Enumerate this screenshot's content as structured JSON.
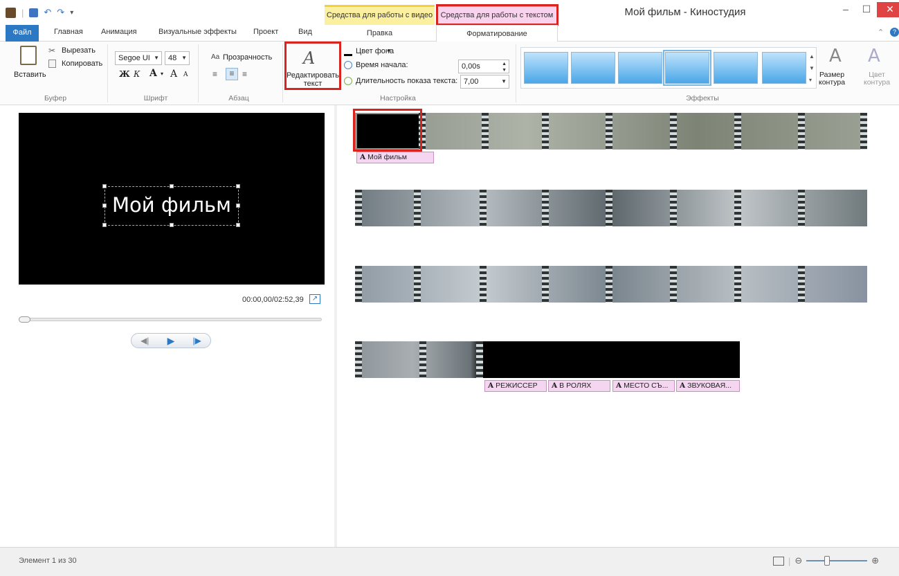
{
  "window": {
    "title": "Мой фильм - Киностудия",
    "minimize": "–",
    "maximize": "☐",
    "close": "✕"
  },
  "context_tabs": {
    "video_tools": "Средства для работы с видео",
    "text_tools": "Средства для работы с текстом"
  },
  "tabs": {
    "file": "Файл",
    "home": "Главная",
    "animation": "Анимация",
    "visual_effects": "Визуальные эффекты",
    "project": "Проект",
    "view": "Вид",
    "edit": "Правка",
    "format": "Форматирование"
  },
  "ribbon": {
    "clipboard": {
      "paste": "Вставить",
      "cut": "Вырезать",
      "copy": "Копировать",
      "group": "Буфер"
    },
    "font": {
      "family": "Segoe UI",
      "size": "48",
      "bold": "Ж",
      "italic": "К",
      "color": "A",
      "grow": "A",
      "shrink": "A",
      "group": "Шрифт"
    },
    "paragraph": {
      "transparency": "Прозрачность",
      "group": "Абзац"
    },
    "edit_text": {
      "line1": "Редактировать",
      "line2": "текст"
    },
    "settings": {
      "bg_color": "Цвет фона",
      "start_time_label": "Время начала:",
      "start_time": "0,00s",
      "duration_label": "Длительность показа текста:",
      "duration": "7,00",
      "group": "Настройка"
    },
    "effects": {
      "group": "Эффекты",
      "outline_size_1": "Размер",
      "outline_size_2": "контура",
      "outline_color_1": "Цвет",
      "outline_color_2": "контура"
    }
  },
  "preview": {
    "text": "Мой фильм",
    "timecode": "00:00,00/02:52,39"
  },
  "storyboard": {
    "caption_first": "Мой фильм",
    "captions_end": [
      "РЕЖИССЕР",
      "В РОЛЯХ",
      "МЕСТО СЪ...",
      "ЗВУКОВАЯ..."
    ]
  },
  "status": {
    "text": "Элемент 1 из 30"
  },
  "icons": [
    "film-icon",
    "save-icon",
    "undo-icon",
    "redo-icon",
    "paste-icon",
    "cut-icon",
    "copy-icon",
    "edit-text-icon",
    "clock-icon",
    "play-icon",
    "expand-icon",
    "zoom-out-icon",
    "zoom-in-icon"
  ]
}
